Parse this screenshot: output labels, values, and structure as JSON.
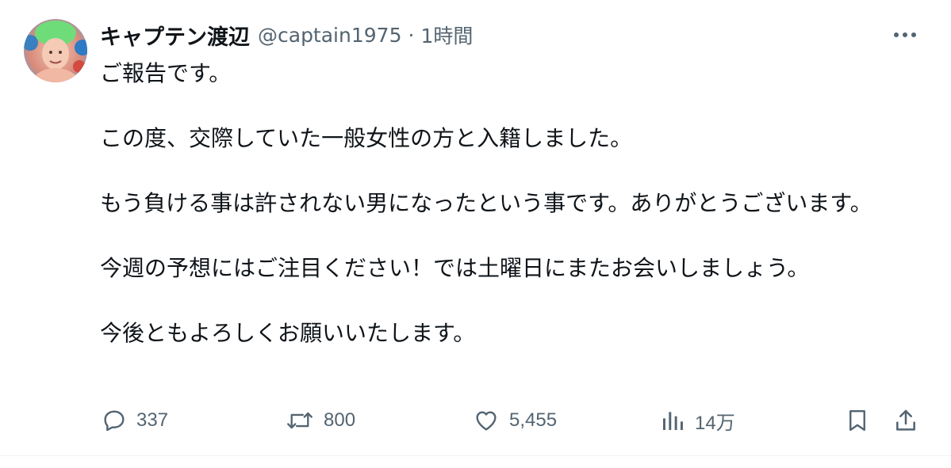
{
  "user": {
    "display_name": "キャプテン渡辺",
    "handle": "@captain1975",
    "separator": "·",
    "time": "1時間"
  },
  "tweet": {
    "paragraphs": [
      "ご報告です。",
      "この度、交際していた一般女性の方と入籍しました。",
      "もう負ける事は許されない男になったという事です。ありがとうございます。",
      "今週の予想にはご注目ください！では土曜日にまたお会いしましょう。",
      "今後ともよろしくお願いいたします。"
    ]
  },
  "actions": {
    "replies": "337",
    "retweets": "800",
    "likes": "5,455",
    "views": "14万"
  },
  "icons": {
    "more": "more-dots-icon",
    "reply": "reply-icon",
    "retweet": "retweet-icon",
    "like": "heart-icon",
    "views": "analytics-icon",
    "bookmark": "bookmark-icon",
    "share": "share-icon"
  },
  "colors": {
    "text": "#0f1419",
    "secondary": "#536471",
    "border": "#eff3f4"
  }
}
